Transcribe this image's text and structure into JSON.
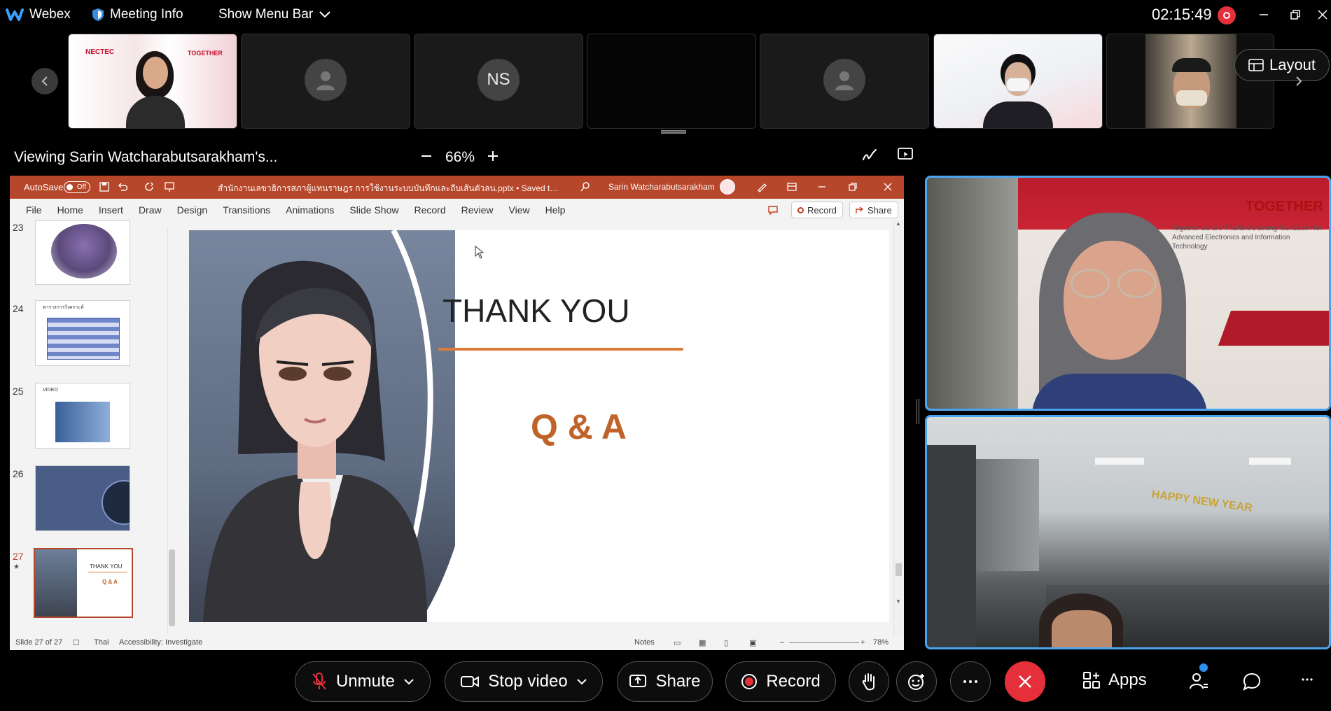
{
  "topbar": {
    "app_name": "Webex",
    "meeting_info": "Meeting Info",
    "show_menu_bar": "Show Menu Bar",
    "clock": "02:15:49"
  },
  "thumbnails": {
    "initials": "NS",
    "layout_label": "Layout",
    "banner_logo": "NECTEC",
    "banner_text": "TOGETHER"
  },
  "share": {
    "viewing_label": "Viewing Sarin Watcharabutsarakham's...",
    "zoom": "66%"
  },
  "ppt": {
    "autosave": "AutoSave",
    "autosave_state": "Off",
    "file_title": "สำนักงานเลขาธิการสภาผู้แทนราษฎร การใช้งานระบบบันทึกและถีบเส้นตัวลน.pptx • Saved to this PC",
    "user_name": "Sarin Watcharabutsarakham",
    "menu": [
      "File",
      "Home",
      "Insert",
      "Draw",
      "Design",
      "Transitions",
      "Animations",
      "Slide Show",
      "Record",
      "Review",
      "View",
      "Help"
    ],
    "record_btn": "Record",
    "share_btn": "Share",
    "slide_numbers": [
      "23",
      "24",
      "25",
      "26",
      "27"
    ],
    "thumb24_title": "ตารางการวิเคราะห์",
    "thumb25_title": "VIDEO",
    "thumb27_title": "THANK YOU",
    "thumb27_sub": "Q & A",
    "slide_title": "THANK YOU",
    "slide_sub": "Q & A",
    "status_slide": "Slide 27 of 27",
    "status_lang": "Thai",
    "status_access": "Accessibility: Investigate",
    "status_notes": "Notes",
    "status_zoom": "78%"
  },
  "video": {
    "tile1_banner": "TOGETHER",
    "tile1_tagline": "Together we are Thailand's strong foundation for Advanced Electronics and Information Technology",
    "tile2_banner": "HAPPY NEW YEAR"
  },
  "controls": {
    "unmute": "Unmute",
    "stop_video": "Stop video",
    "share": "Share",
    "record": "Record",
    "apps": "Apps"
  },
  "colors": {
    "ppt_red": "#b7472a",
    "orange": "#c0632a",
    "leave_red": "#e5303b",
    "active_border": "#4aa5f0"
  }
}
